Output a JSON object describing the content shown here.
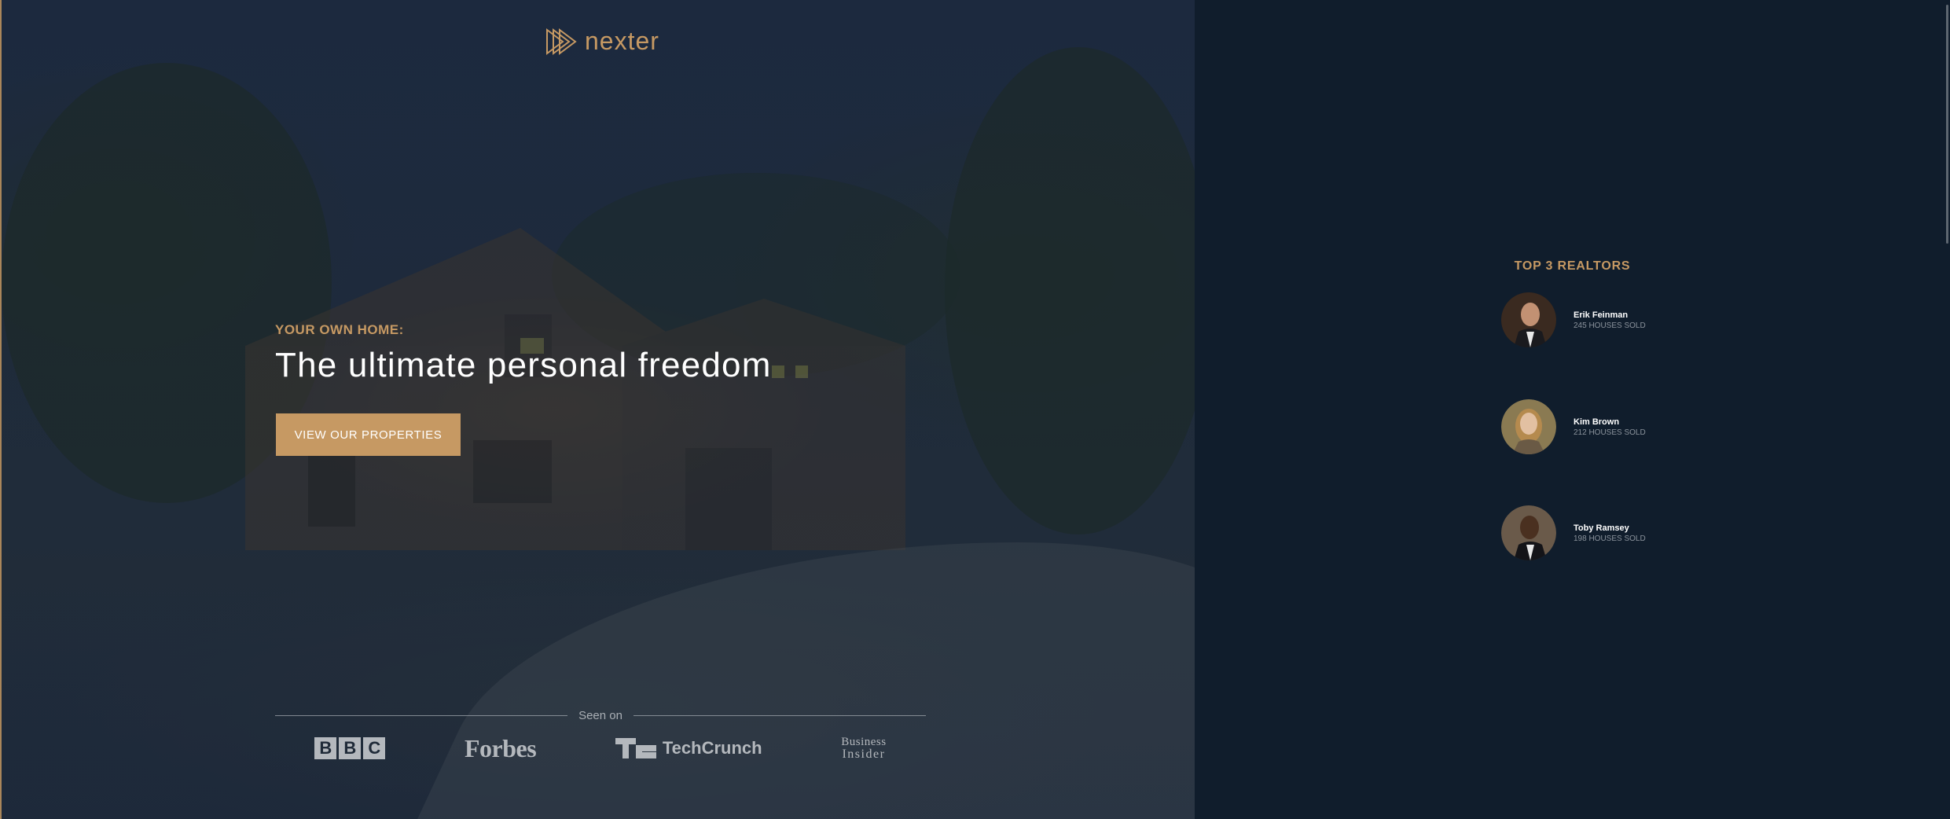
{
  "brand": {
    "name": "nexter",
    "accent": "#c69963",
    "dark": "#101d2c"
  },
  "hero": {
    "subtitle": "Your own home:",
    "headline": "The ultimate personal freedom",
    "cta_label": "View our properties"
  },
  "seen_on": {
    "label": "Seen on",
    "logos": [
      "BBC",
      "Forbes",
      "TechCrunch",
      "Business Insider"
    ],
    "bbc_letters": [
      "B",
      "B",
      "C"
    ],
    "forbes": "Forbes",
    "techcrunch": "TechCrunch",
    "business_insider_line1": "Business",
    "business_insider_line2": "Insider"
  },
  "realtors": {
    "title": "Top 3 Realtors",
    "items": [
      {
        "name": "Erik Feinman",
        "sold": "245 houses sold"
      },
      {
        "name": "Kim Brown",
        "sold": "212 houses sold"
      },
      {
        "name": "Toby Ramsey",
        "sold": "198 houses sold"
      }
    ]
  }
}
